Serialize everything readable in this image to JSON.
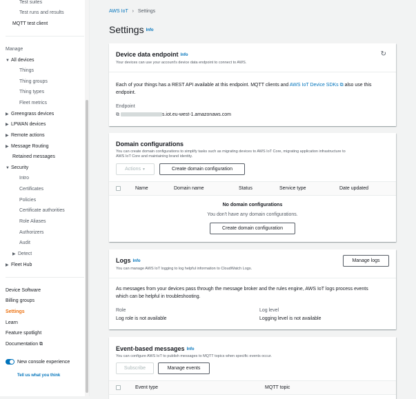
{
  "sidebar": {
    "top_items": [
      {
        "label": "Test suites"
      },
      {
        "label": "Test runs and results"
      },
      {
        "label": "MQTT test client"
      }
    ],
    "manage_label": "Manage",
    "all_devices": "All devices",
    "device_items": [
      "Things",
      "Thing groups",
      "Thing types",
      "Fleet metrics"
    ],
    "groups": [
      "Greengrass devices",
      "LPWAN devices",
      "Remote actions",
      "Message Routing"
    ],
    "retained": "Retained messages",
    "security": "Security",
    "security_items": [
      "Intro",
      "Certificates",
      "Policies",
      "Certificate authorities",
      "Role Aliases",
      "Authorizers",
      "Audit"
    ],
    "detect": "Detect",
    "fleet_hub": "Fleet Hub",
    "bottom_items": [
      "Device Software",
      "Billing groups"
    ],
    "settings": "Settings",
    "learn": "Learn",
    "feature_spotlight": "Feature spotlight",
    "documentation": "Documentation",
    "new_console": "New console experience",
    "feedback": "Tell us what you think"
  },
  "breadcrumb": {
    "root": "AWS IoT",
    "current": "Settings"
  },
  "page": {
    "title": "Settings",
    "info": "Info"
  },
  "endpoint_card": {
    "title": "Device data endpoint",
    "info": "Info",
    "description": "Your devices can use your account's device data endpoint to connect to AWS.",
    "body_pre": "Each of your things has a REST API available at this endpoint. MQTT clients and",
    "body_link": "AWS IoT Device SDKs",
    "body_post": "also use this",
    "body_line2": "endpoint.",
    "endpoint_label": "Endpoint",
    "endpoint_value": "s.iot.eu-west-1.amazonaws.com"
  },
  "domain_card": {
    "title": "Domain configurations",
    "description_line1": "You can create domain configurations to simplify tasks such as migrating devices to AWS IoT Core, migrating application infrastructure to",
    "description_line2": "AWS IoT Core and maintaining brand identity.",
    "actions_label": "Actions",
    "create_label": "Create domain configuration",
    "columns": [
      "Name",
      "Domain name",
      "Status",
      "Service type",
      "Date updated"
    ],
    "empty_title": "No domain configurations",
    "empty_text": "You don't have any domain configurations.",
    "empty_button": "Create domain configuration"
  },
  "logs_card": {
    "title": "Logs",
    "info": "Info",
    "description": "You can manage AWS IoT logging to log helpful information to CloudWatch Logs.",
    "manage_label": "Manage logs",
    "body_line1": "As messages from your devices pass through the message broker and the rules engine, AWS IoT logs process events",
    "body_line2": "which can be helpful in troubleshooting.",
    "role_label": "Role",
    "role_value": "Log role is not available",
    "level_label": "Log level",
    "level_value": "Logging level is not available"
  },
  "events_card": {
    "title": "Event-based messages",
    "info": "Info",
    "description": "You can configure AWS IoT to publish messages to MQTT topics when specific events occur.",
    "subscribe_label": "Subscribe",
    "manage_label": "Manage events",
    "columns": [
      "Event type",
      "MQTT topic"
    ]
  }
}
